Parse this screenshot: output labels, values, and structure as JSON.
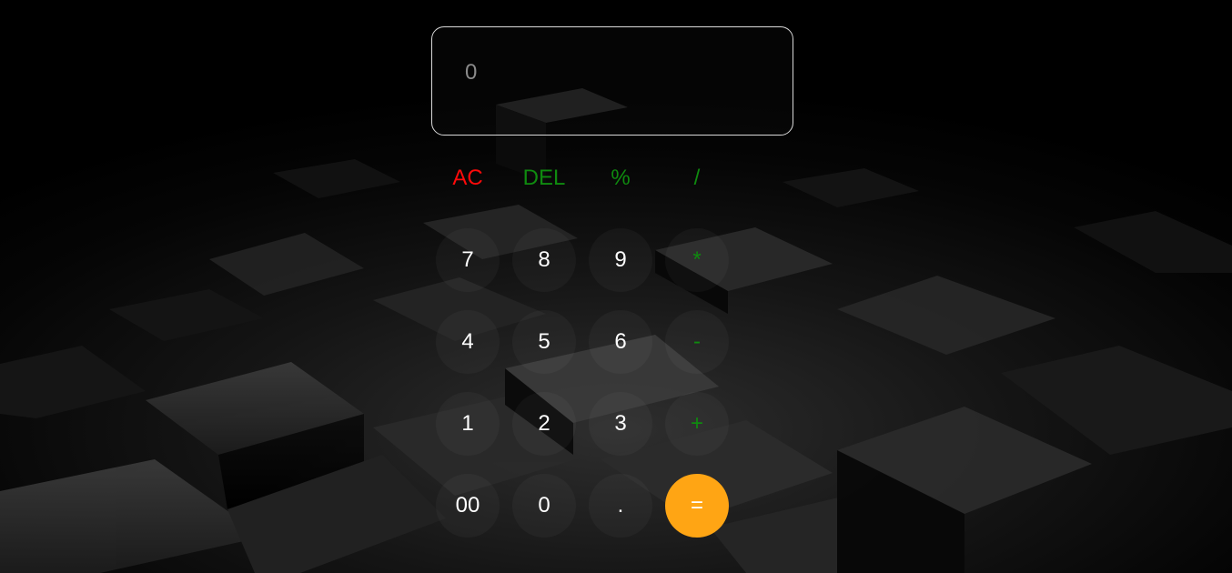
{
  "display": {
    "value": "0"
  },
  "colors": {
    "clear": "#ff0a0a",
    "operator": "#0f8a0f",
    "digit": "#ffffff",
    "equals_bg": "#ffa514",
    "display_border": "#d8d8d8",
    "display_text": "#8a8a8a"
  },
  "keys": {
    "ac": "AC",
    "del": "DEL",
    "percent": "%",
    "divide": "/",
    "seven": "7",
    "eight": "8",
    "nine": "9",
    "multiply": "*",
    "four": "4",
    "five": "5",
    "six": "6",
    "minus": "-",
    "one": "1",
    "two": "2",
    "three": "3",
    "plus": "+",
    "double_zero": "00",
    "zero": "0",
    "dot": ".",
    "equals": "="
  }
}
